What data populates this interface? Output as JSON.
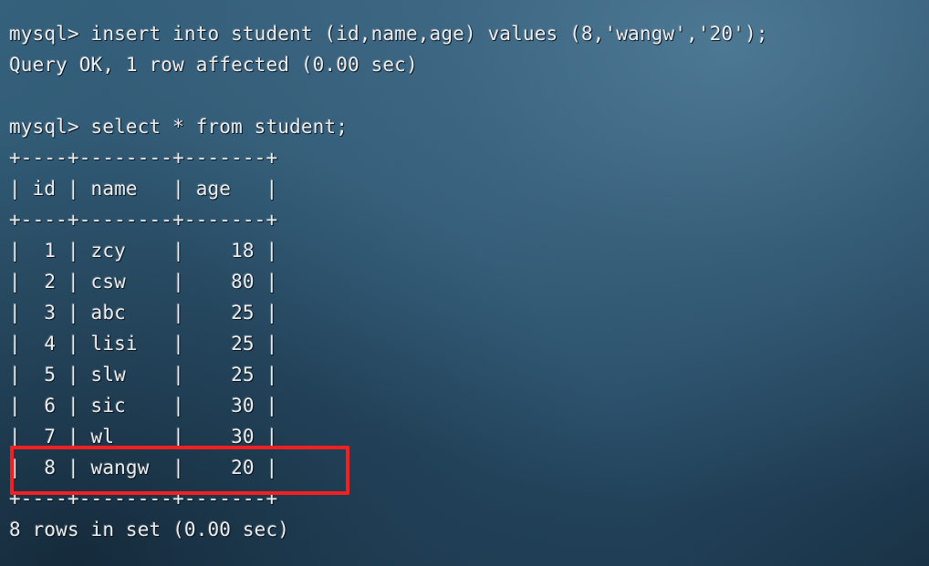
{
  "terminal": {
    "prompt": "mysql>",
    "background_color": "#2d5771",
    "text_color": "#eceef0",
    "highlight_color": "#f22020",
    "lines": [
      "mysql> insert into student (id,name,age) values (8,'wangw','20');",
      "Query OK, 1 row affected (0.00 sec)",
      "",
      "mysql> select * from student;",
      "+----+--------+-------+",
      "| id | name   | age   |",
      "+----+--------+-------+",
      "|  1 | zcy    |    18 |",
      "|  2 | csw    |    80 |",
      "|  3 | abc    |    25 |",
      "|  4 | lisi   |    25 |",
      "|  5 | slw    |    25 |",
      "|  6 | sic    |    30 |",
      "|  7 | wl     |    30 |",
      "|  8 | wangw  |    20 |",
      "+----+--------+-------+",
      "8 rows in set (0.00 sec)"
    ],
    "full_text": "mysql> insert into student (id,name,age) values (8,'wangw','20');\nQuery OK, 1 row affected (0.00 sec)\n\nmysql> select * from student;\n+----+--------+-------+\n| id | name   | age   |\n+----+--------+-------+\n|  1 | zcy    |    18 |\n|  2 | csw    |    80 |\n|  3 | abc    |    25 |\n|  4 | lisi   |    25 |\n|  5 | slw    |    25 |\n|  6 | sic    |    30 |\n|  7 | wl     |    30 |\n|  8 | wangw  |    20 |\n+----+--------+-------+\n8 rows in set (0.00 sec)",
    "commands": [
      {
        "statement": "insert into student (id,name,age) values (8,'wangw','20');",
        "result": "Query OK, 1 row affected (0.00 sec)"
      },
      {
        "statement": "select * from student;",
        "result": "8 rows in set (0.00 sec)"
      }
    ],
    "result_table": {
      "headers": [
        "id",
        "name",
        "age"
      ],
      "rows": [
        [
          "1",
          "zcy",
          "18"
        ],
        [
          "2",
          "csw",
          "80"
        ],
        [
          "3",
          "abc",
          "25"
        ],
        [
          "4",
          "lisi",
          "25"
        ],
        [
          "5",
          "slw",
          "25"
        ],
        [
          "6",
          "sic",
          "30"
        ],
        [
          "7",
          "wl",
          "30"
        ],
        [
          "8",
          "wangw",
          "20"
        ]
      ],
      "highlighted_row_index": 7,
      "row_count_label": "8 rows in set (0.00 sec)"
    }
  }
}
